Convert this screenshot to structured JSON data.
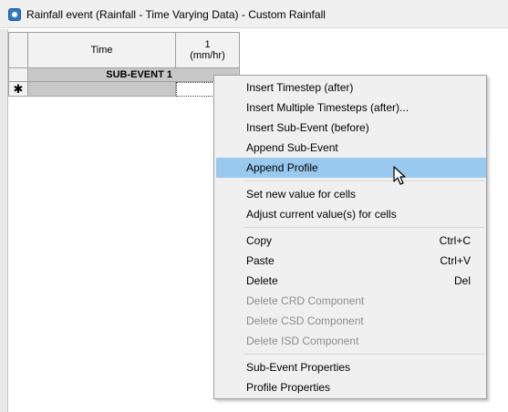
{
  "window": {
    "title": "Rainfall event (Rainfall - Time Varying Data) - Custom Rainfall",
    "icon": "app-icon"
  },
  "grid": {
    "columns": [
      {
        "label": "Time"
      },
      {
        "label_line1": "1",
        "label_line2": "(mm/hr)"
      }
    ],
    "rows": [
      {
        "type": "sub-event",
        "label": "SUB-EVENT 1"
      },
      {
        "type": "new-row",
        "marker": "✱"
      }
    ]
  },
  "context_menu": {
    "items": [
      {
        "label": "Insert Timestep (after)",
        "shortcut": "",
        "enabled": true
      },
      {
        "label": "Insert Multiple Timesteps (after)...",
        "shortcut": "",
        "enabled": true
      },
      {
        "label": "Insert Sub-Event (before)",
        "shortcut": "",
        "enabled": true
      },
      {
        "label": "Append Sub-Event",
        "shortcut": "",
        "enabled": true
      },
      {
        "label": "Append Profile",
        "shortcut": "",
        "enabled": true,
        "highlighted": true
      },
      {
        "label": "Set new value for cells",
        "shortcut": "",
        "enabled": true
      },
      {
        "label": "Adjust current value(s) for cells",
        "shortcut": "",
        "enabled": true
      },
      {
        "label": "Copy",
        "shortcut": "Ctrl+C",
        "enabled": true
      },
      {
        "label": "Paste",
        "shortcut": "Ctrl+V",
        "enabled": true
      },
      {
        "label": "Delete",
        "shortcut": "Del",
        "enabled": true
      },
      {
        "label": "Delete CRD Component",
        "shortcut": "",
        "enabled": false
      },
      {
        "label": "Delete CSD Component",
        "shortcut": "",
        "enabled": false
      },
      {
        "label": "Delete ISD Component",
        "shortcut": "",
        "enabled": false
      },
      {
        "label": "Sub-Event Properties",
        "shortcut": "",
        "enabled": true
      },
      {
        "label": "Profile Properties",
        "shortcut": "",
        "enabled": true
      }
    ]
  },
  "colors": {
    "highlight": "#99c9ef",
    "disabled_text": "#8d8d8d",
    "menu_background": "#f0f0f0",
    "grid_shaded_cell": "#c8c8c8"
  }
}
